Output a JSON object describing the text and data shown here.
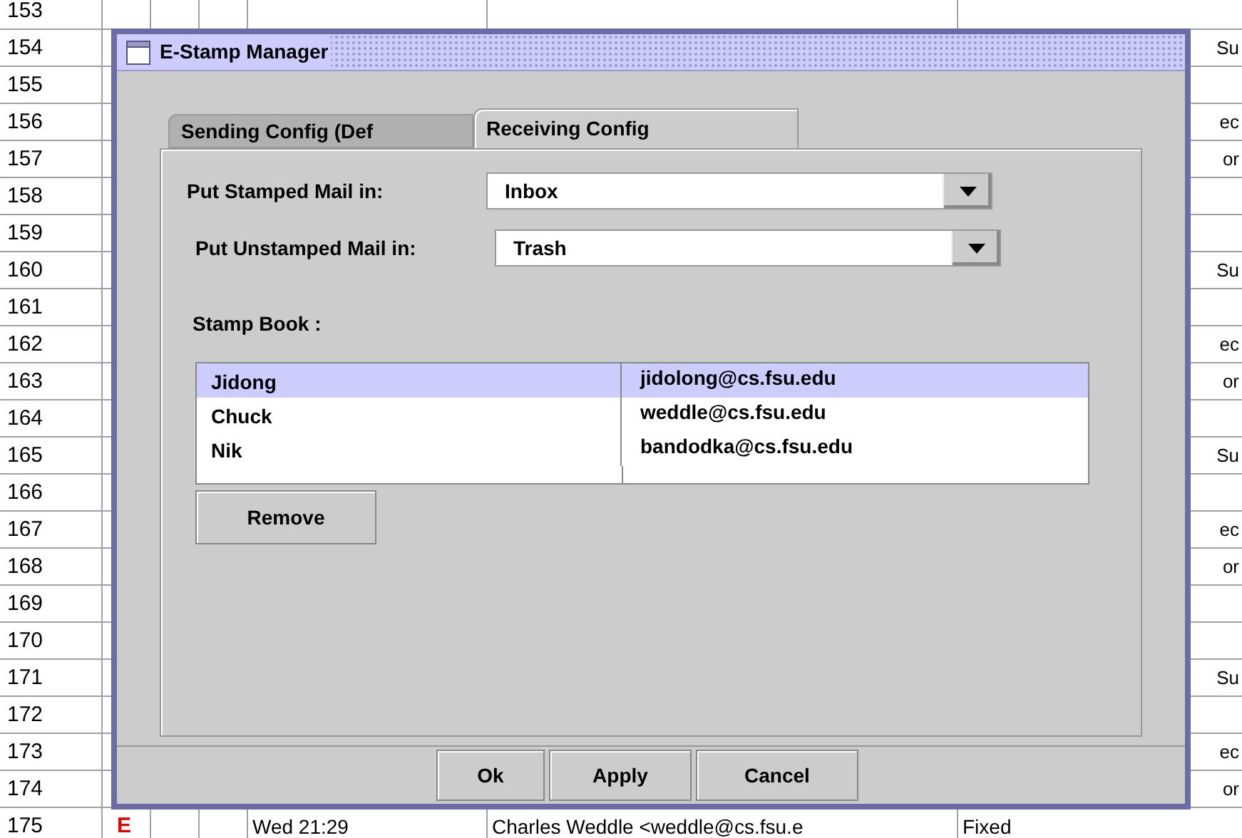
{
  "sheet": {
    "rows": [
      {
        "number": "153",
        "cells": []
      },
      {
        "number": "154",
        "cells": [],
        "edge": "Su"
      },
      {
        "number": "155",
        "cells": []
      },
      {
        "number": "156",
        "cells": [],
        "edge": "ec"
      },
      {
        "number": "157",
        "cells": [],
        "edge": "or"
      },
      {
        "number": "158",
        "cells": []
      },
      {
        "number": "159",
        "cells": []
      },
      {
        "number": "160",
        "cells": [],
        "edge": "Su"
      },
      {
        "number": "161",
        "cells": []
      },
      {
        "number": "162",
        "cells": [],
        "edge": "ec"
      },
      {
        "number": "163",
        "cells": [],
        "edge": "or"
      },
      {
        "number": "164",
        "cells": []
      },
      {
        "number": "165",
        "cells": [],
        "edge": "Su"
      },
      {
        "number": "166",
        "cells": []
      },
      {
        "number": "167",
        "cells": [],
        "edge": "ec"
      },
      {
        "number": "168",
        "cells": [],
        "edge": "or"
      },
      {
        "number": "169",
        "cells": []
      },
      {
        "number": "170",
        "cells": []
      },
      {
        "number": "171",
        "cells": [],
        "edge": "Su"
      },
      {
        "number": "172",
        "cells": []
      },
      {
        "number": "173",
        "cells": [],
        "edge": "ec"
      },
      {
        "number": "174",
        "cells": [],
        "edge": "or"
      },
      {
        "number": "175",
        "flag": "E",
        "cells": [
          "Wed 21:29",
          "Charles Weddle <weddle@cs.fsu.e",
          "Fixed"
        ]
      }
    ]
  },
  "dialog": {
    "title": "E-Stamp Manager",
    "tabs": [
      {
        "label": "Sending Config (Def",
        "selected": false
      },
      {
        "label": "Receiving Config",
        "selected": true
      }
    ],
    "fields": [
      {
        "label": "Put Stamped Mail in:",
        "value": "Inbox"
      },
      {
        "label": "Put Unstamped Mail in:",
        "value": "Trash"
      }
    ],
    "stamp_book": {
      "label": "Stamp Book :",
      "rows": [
        {
          "name": "Jidong",
          "email": "jidolong@cs.fsu.edu",
          "selected": true
        },
        {
          "name": "Chuck",
          "email": "weddle@cs.fsu.edu",
          "selected": false
        },
        {
          "name": "Nik",
          "email": "bandodka@cs.fsu.edu",
          "selected": false
        }
      ]
    },
    "remove_button": "Remove",
    "buttons": [
      "Ok",
      "Apply",
      "Cancel"
    ]
  }
}
